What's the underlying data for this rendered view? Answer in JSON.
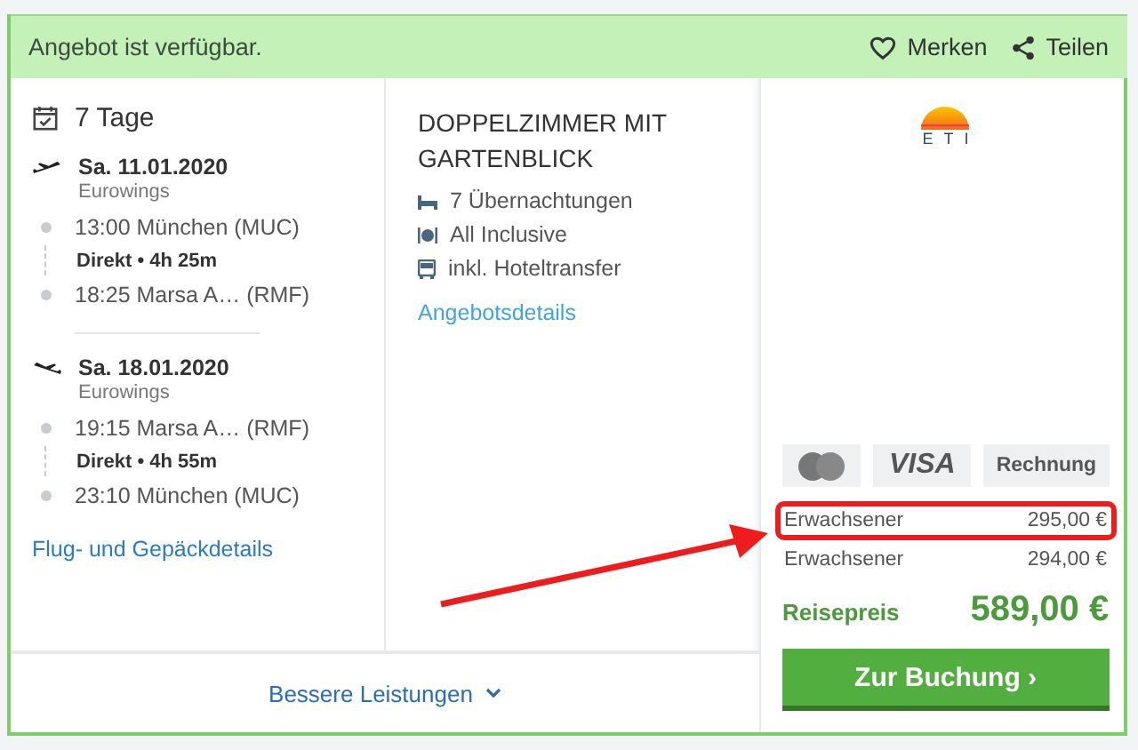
{
  "header": {
    "status": "Angebot ist verfügbar.",
    "actions": [
      {
        "kind": "heart",
        "label": "Merken"
      },
      {
        "kind": "share",
        "label": "Teilen"
      }
    ]
  },
  "trip": {
    "duration": "7 Tage",
    "legs": [
      {
        "kind": "outbound",
        "date": "Sa. 11.01.2020",
        "airline": "Eurowings",
        "departure": "13:00 München (MUC)",
        "info": "Direkt • 4h 25m",
        "arrival": "18:25 Marsa A… (RMF)"
      },
      {
        "kind": "return",
        "date": "Sa. 18.01.2020",
        "airline": "Eurowings",
        "departure": "19:15 Marsa A… (RMF)",
        "info": "Direkt • 4h 55m",
        "arrival": "23:10 München (MUC)"
      }
    ],
    "details_link": "Flug- und Gepäckdetails"
  },
  "room": {
    "title": "DOPPELZIMMER MIT GARTENBLICK",
    "features": [
      {
        "kind": "bed",
        "text": "7 Übernachtungen"
      },
      {
        "kind": "meal",
        "text": "All Inclusive"
      },
      {
        "kind": "bus",
        "text": "inkl. Hoteltransfer"
      }
    ],
    "details_link": "Angebotsdetails"
  },
  "operator": {
    "logo_text": "ETI"
  },
  "payment": [
    {
      "kind": "mastercard"
    },
    {
      "kind": "visa",
      "label": "VISA"
    },
    {
      "kind": "text",
      "label": "Rechnung"
    }
  ],
  "prices": [
    {
      "label": "Erwachsener",
      "amount": "295,00 €",
      "highlighted": true
    },
    {
      "label": "Erwachsener",
      "amount": "294,00 €",
      "highlighted": false
    }
  ],
  "total": {
    "label": "Reisepreis",
    "amount": "589,00 €"
  },
  "book_button": "Zur Buchung ›",
  "more_link": "Bessere Leistungen"
}
